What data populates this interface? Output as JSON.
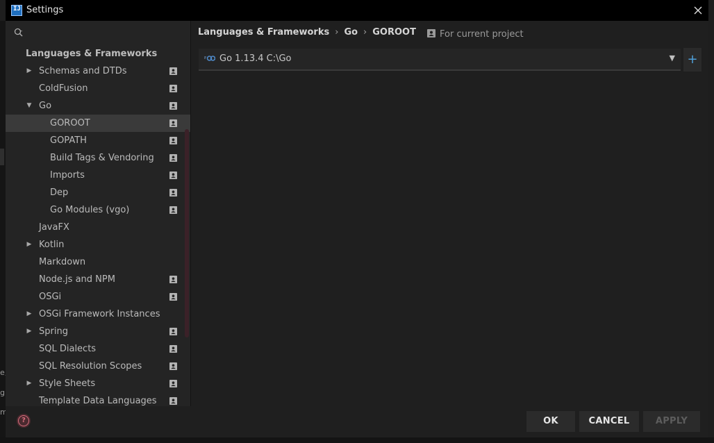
{
  "window": {
    "title": "Settings"
  },
  "search": {
    "placeholder": ""
  },
  "tree": {
    "items": [
      {
        "label": "Languages & Frameworks",
        "type": "header"
      },
      {
        "label": "Schemas and DTDs",
        "arrow": "collapsed",
        "level": 1,
        "project": true
      },
      {
        "label": "ColdFusion",
        "level": 1,
        "project": true
      },
      {
        "label": "Go",
        "arrow": "expanded",
        "level": 1,
        "project": true
      },
      {
        "label": "GOROOT",
        "level": 2,
        "project": true,
        "selected": true
      },
      {
        "label": "GOPATH",
        "level": 2,
        "project": true
      },
      {
        "label": "Build Tags & Vendoring",
        "level": 2,
        "project": true
      },
      {
        "label": "Imports",
        "level": 2,
        "project": true
      },
      {
        "label": "Dep",
        "level": 2,
        "project": true
      },
      {
        "label": "Go Modules (vgo)",
        "level": 2,
        "project": true
      },
      {
        "label": "JavaFX",
        "level": 1
      },
      {
        "label": "Kotlin",
        "arrow": "collapsed",
        "level": 1
      },
      {
        "label": "Markdown",
        "level": 1
      },
      {
        "label": "Node.js and NPM",
        "level": 1,
        "project": true
      },
      {
        "label": "OSGi",
        "level": 1,
        "project": true
      },
      {
        "label": "OSGi Framework Instances",
        "arrow": "collapsed",
        "level": 1
      },
      {
        "label": "Spring",
        "arrow": "collapsed",
        "level": 1,
        "project": true
      },
      {
        "label": "SQL Dialects",
        "level": 1,
        "project": true
      },
      {
        "label": "SQL Resolution Scopes",
        "level": 1,
        "project": true
      },
      {
        "label": "Style Sheets",
        "arrow": "collapsed",
        "level": 1,
        "project": true
      },
      {
        "label": "Template Data Languages",
        "level": 1,
        "project": true
      }
    ]
  },
  "breadcrumb": {
    "part1": "Languages & Frameworks",
    "part2": "Go",
    "part3": "GOROOT",
    "separator": "›"
  },
  "scope": {
    "label": "For current project"
  },
  "sdk": {
    "value": "Go 1.13.4 C:\\Go",
    "dropdown_glyph": "▼",
    "add_glyph": "+"
  },
  "footer": {
    "help_glyph": "?",
    "ok": "OK",
    "cancel": "CANCEL",
    "apply": "APPLY"
  },
  "background": {
    "fragments": [
      "e,",
      "gl",
      "m"
    ]
  },
  "colors": {
    "accent_add": "#4fa0d9",
    "selected_row": "#3a3a3a",
    "help": "#d76e7d",
    "scrollbar": "#3b2128"
  }
}
